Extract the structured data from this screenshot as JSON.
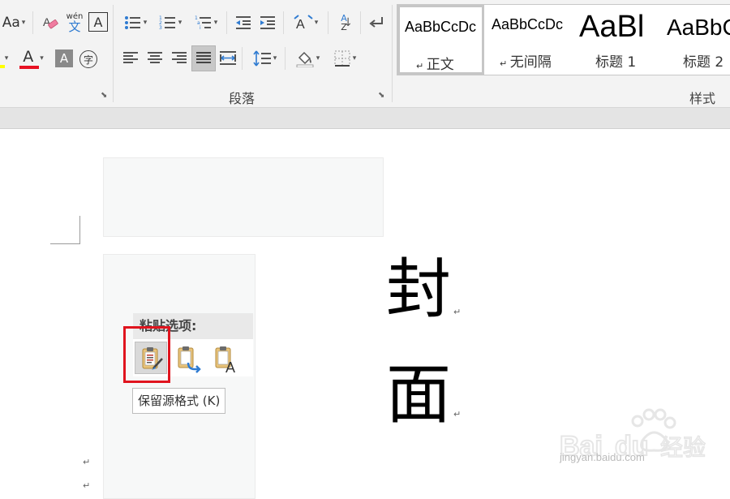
{
  "ribbon": {
    "font_group": {
      "change_case_label": "Aa",
      "phonetic_label": "wén",
      "phonetic_char": "文",
      "char_border_label": "A",
      "font_color_label": "A",
      "shading_label": "A",
      "enclose_label": "字"
    },
    "paragraph_group": {
      "label": "段落",
      "sort_label": "A",
      "sort_label_2": "Z"
    },
    "styles_group": {
      "label": "样式",
      "items": [
        {
          "preview": "AaBbCcDc",
          "name": "正文",
          "has_mark": true
        },
        {
          "preview": "AaBbCcDc",
          "name": "无间隔",
          "has_mark": true
        },
        {
          "preview": "AaBl",
          "name": "标题 1",
          "has_mark": false
        },
        {
          "preview": "AaBbC",
          "name": "标题 2",
          "has_mark": false
        }
      ]
    }
  },
  "document": {
    "cover_chars": [
      "封",
      "面"
    ],
    "paragraph_mark": "↵"
  },
  "paste_options": {
    "header": "粘贴选项:",
    "tooltip": "保留源格式 (K)",
    "buttons": [
      {
        "name": "keep-source-formatting",
        "icon": "paste-keep-source-icon"
      },
      {
        "name": "merge-formatting",
        "icon": "paste-merge-icon"
      },
      {
        "name": "keep-text-only",
        "icon": "paste-text-only-icon"
      }
    ]
  },
  "watermark": {
    "text": "jingyan.baidu.com"
  },
  "colors": {
    "font_color_bar": "#e81123",
    "highlight_bar": "#ffff00",
    "selection_outline": "#e0141e",
    "icon_blue": "#2f7bd1"
  }
}
